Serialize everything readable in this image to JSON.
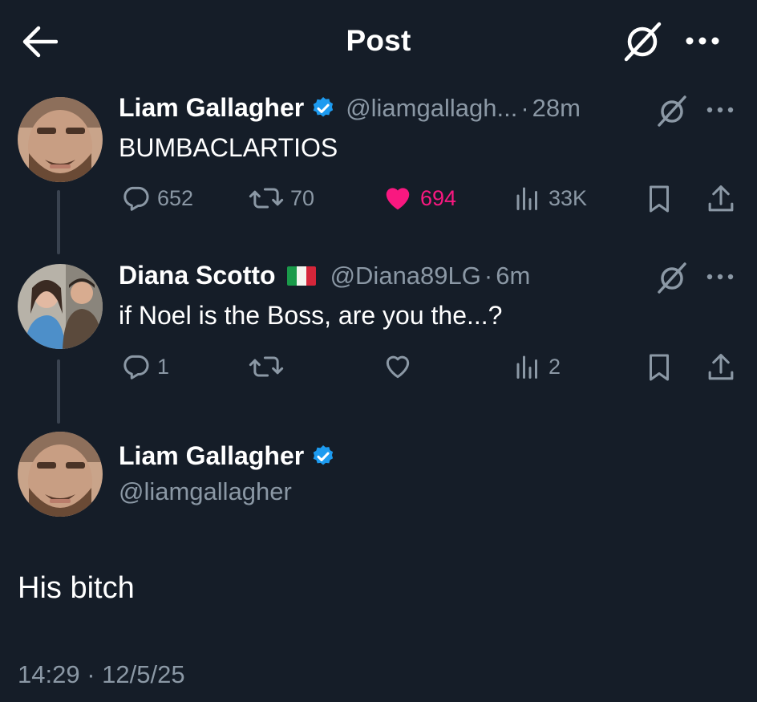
{
  "header": {
    "title": "Post"
  },
  "tweets": [
    {
      "name": "Liam Gallagher",
      "handle": "@liamgallagh...",
      "sep": "·",
      "time": "28m",
      "text": "BUMBACLARTIOS",
      "replies": "652",
      "reposts": "70",
      "likes": "694",
      "views": "33K"
    },
    {
      "name": "Diana Scotto",
      "handle": "@Diana89LG",
      "sep": "·",
      "time": "6m",
      "text": "if Noel is the Boss, are you the...?",
      "replies": "1",
      "reposts": "",
      "likes": "",
      "views": "2"
    }
  ],
  "main": {
    "name": "Liam Gallagher",
    "handle": "@liamgallagher",
    "text": "His bitch",
    "timestamp": "14:29 · 12/5/25"
  },
  "colors": {
    "background": "#151d28",
    "secondary_text": "#8b98a5",
    "verified": "#1d9bf0",
    "like": "#f91880",
    "thread_line": "#3a4350"
  },
  "icons": [
    "back-arrow-icon",
    "grok-icon",
    "more-icon",
    "verified-icon",
    "reply-icon",
    "repost-icon",
    "like-icon",
    "views-icon",
    "bookmark-icon",
    "share-icon",
    "italy-flag-icon"
  ]
}
